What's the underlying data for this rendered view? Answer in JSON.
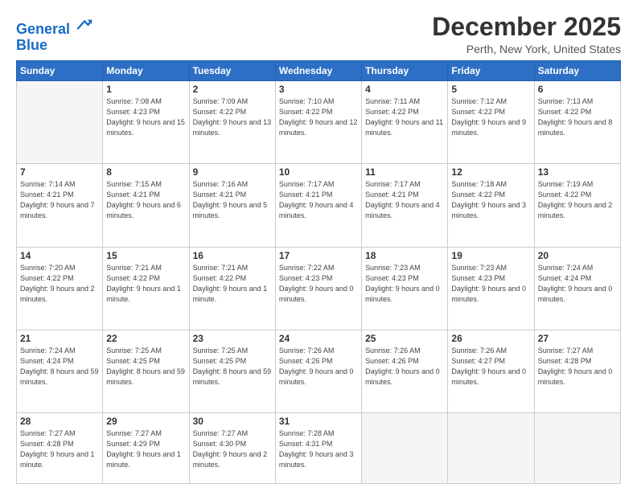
{
  "logo": {
    "line1": "General",
    "line2": "Blue"
  },
  "title": "December 2025",
  "location": "Perth, New York, United States",
  "days_header": [
    "Sunday",
    "Monday",
    "Tuesday",
    "Wednesday",
    "Thursday",
    "Friday",
    "Saturday"
  ],
  "weeks": [
    [
      {
        "day": "",
        "empty": true
      },
      {
        "day": "1",
        "sunrise": "Sunrise: 7:08 AM",
        "sunset": "Sunset: 4:23 PM",
        "daylight": "Daylight: 9 hours and 15 minutes."
      },
      {
        "day": "2",
        "sunrise": "Sunrise: 7:09 AM",
        "sunset": "Sunset: 4:22 PM",
        "daylight": "Daylight: 9 hours and 13 minutes."
      },
      {
        "day": "3",
        "sunrise": "Sunrise: 7:10 AM",
        "sunset": "Sunset: 4:22 PM",
        "daylight": "Daylight: 9 hours and 12 minutes."
      },
      {
        "day": "4",
        "sunrise": "Sunrise: 7:11 AM",
        "sunset": "Sunset: 4:22 PM",
        "daylight": "Daylight: 9 hours and 11 minutes."
      },
      {
        "day": "5",
        "sunrise": "Sunrise: 7:12 AM",
        "sunset": "Sunset: 4:22 PM",
        "daylight": "Daylight: 9 hours and 9 minutes."
      },
      {
        "day": "6",
        "sunrise": "Sunrise: 7:13 AM",
        "sunset": "Sunset: 4:22 PM",
        "daylight": "Daylight: 9 hours and 8 minutes."
      }
    ],
    [
      {
        "day": "7",
        "sunrise": "Sunrise: 7:14 AM",
        "sunset": "Sunset: 4:21 PM",
        "daylight": "Daylight: 9 hours and 7 minutes."
      },
      {
        "day": "8",
        "sunrise": "Sunrise: 7:15 AM",
        "sunset": "Sunset: 4:21 PM",
        "daylight": "Daylight: 9 hours and 6 minutes."
      },
      {
        "day": "9",
        "sunrise": "Sunrise: 7:16 AM",
        "sunset": "Sunset: 4:21 PM",
        "daylight": "Daylight: 9 hours and 5 minutes."
      },
      {
        "day": "10",
        "sunrise": "Sunrise: 7:17 AM",
        "sunset": "Sunset: 4:21 PM",
        "daylight": "Daylight: 9 hours and 4 minutes."
      },
      {
        "day": "11",
        "sunrise": "Sunrise: 7:17 AM",
        "sunset": "Sunset: 4:21 PM",
        "daylight": "Daylight: 9 hours and 4 minutes."
      },
      {
        "day": "12",
        "sunrise": "Sunrise: 7:18 AM",
        "sunset": "Sunset: 4:22 PM",
        "daylight": "Daylight: 9 hours and 3 minutes."
      },
      {
        "day": "13",
        "sunrise": "Sunrise: 7:19 AM",
        "sunset": "Sunset: 4:22 PM",
        "daylight": "Daylight: 9 hours and 2 minutes."
      }
    ],
    [
      {
        "day": "14",
        "sunrise": "Sunrise: 7:20 AM",
        "sunset": "Sunset: 4:22 PM",
        "daylight": "Daylight: 9 hours and 2 minutes."
      },
      {
        "day": "15",
        "sunrise": "Sunrise: 7:21 AM",
        "sunset": "Sunset: 4:22 PM",
        "daylight": "Daylight: 9 hours and 1 minute."
      },
      {
        "day": "16",
        "sunrise": "Sunrise: 7:21 AM",
        "sunset": "Sunset: 4:22 PM",
        "daylight": "Daylight: 9 hours and 1 minute."
      },
      {
        "day": "17",
        "sunrise": "Sunrise: 7:22 AM",
        "sunset": "Sunset: 4:23 PM",
        "daylight": "Daylight: 9 hours and 0 minutes."
      },
      {
        "day": "18",
        "sunrise": "Sunrise: 7:23 AM",
        "sunset": "Sunset: 4:23 PM",
        "daylight": "Daylight: 9 hours and 0 minutes."
      },
      {
        "day": "19",
        "sunrise": "Sunrise: 7:23 AM",
        "sunset": "Sunset: 4:23 PM",
        "daylight": "Daylight: 9 hours and 0 minutes."
      },
      {
        "day": "20",
        "sunrise": "Sunrise: 7:24 AM",
        "sunset": "Sunset: 4:24 PM",
        "daylight": "Daylight: 9 hours and 0 minutes."
      }
    ],
    [
      {
        "day": "21",
        "sunrise": "Sunrise: 7:24 AM",
        "sunset": "Sunset: 4:24 PM",
        "daylight": "Daylight: 8 hours and 59 minutes."
      },
      {
        "day": "22",
        "sunrise": "Sunrise: 7:25 AM",
        "sunset": "Sunset: 4:25 PM",
        "daylight": "Daylight: 8 hours and 59 minutes."
      },
      {
        "day": "23",
        "sunrise": "Sunrise: 7:25 AM",
        "sunset": "Sunset: 4:25 PM",
        "daylight": "Daylight: 8 hours and 59 minutes."
      },
      {
        "day": "24",
        "sunrise": "Sunrise: 7:26 AM",
        "sunset": "Sunset: 4:26 PM",
        "daylight": "Daylight: 9 hours and 0 minutes."
      },
      {
        "day": "25",
        "sunrise": "Sunrise: 7:26 AM",
        "sunset": "Sunset: 4:26 PM",
        "daylight": "Daylight: 9 hours and 0 minutes."
      },
      {
        "day": "26",
        "sunrise": "Sunrise: 7:26 AM",
        "sunset": "Sunset: 4:27 PM",
        "daylight": "Daylight: 9 hours and 0 minutes."
      },
      {
        "day": "27",
        "sunrise": "Sunrise: 7:27 AM",
        "sunset": "Sunset: 4:28 PM",
        "daylight": "Daylight: 9 hours and 0 minutes."
      }
    ],
    [
      {
        "day": "28",
        "sunrise": "Sunrise: 7:27 AM",
        "sunset": "Sunset: 4:28 PM",
        "daylight": "Daylight: 9 hours and 1 minute."
      },
      {
        "day": "29",
        "sunrise": "Sunrise: 7:27 AM",
        "sunset": "Sunset: 4:29 PM",
        "daylight": "Daylight: 9 hours and 1 minute."
      },
      {
        "day": "30",
        "sunrise": "Sunrise: 7:27 AM",
        "sunset": "Sunset: 4:30 PM",
        "daylight": "Daylight: 9 hours and 2 minutes."
      },
      {
        "day": "31",
        "sunrise": "Sunrise: 7:28 AM",
        "sunset": "Sunset: 4:31 PM",
        "daylight": "Daylight: 9 hours and 3 minutes."
      },
      {
        "day": "",
        "empty": true
      },
      {
        "day": "",
        "empty": true
      },
      {
        "day": "",
        "empty": true
      }
    ]
  ]
}
